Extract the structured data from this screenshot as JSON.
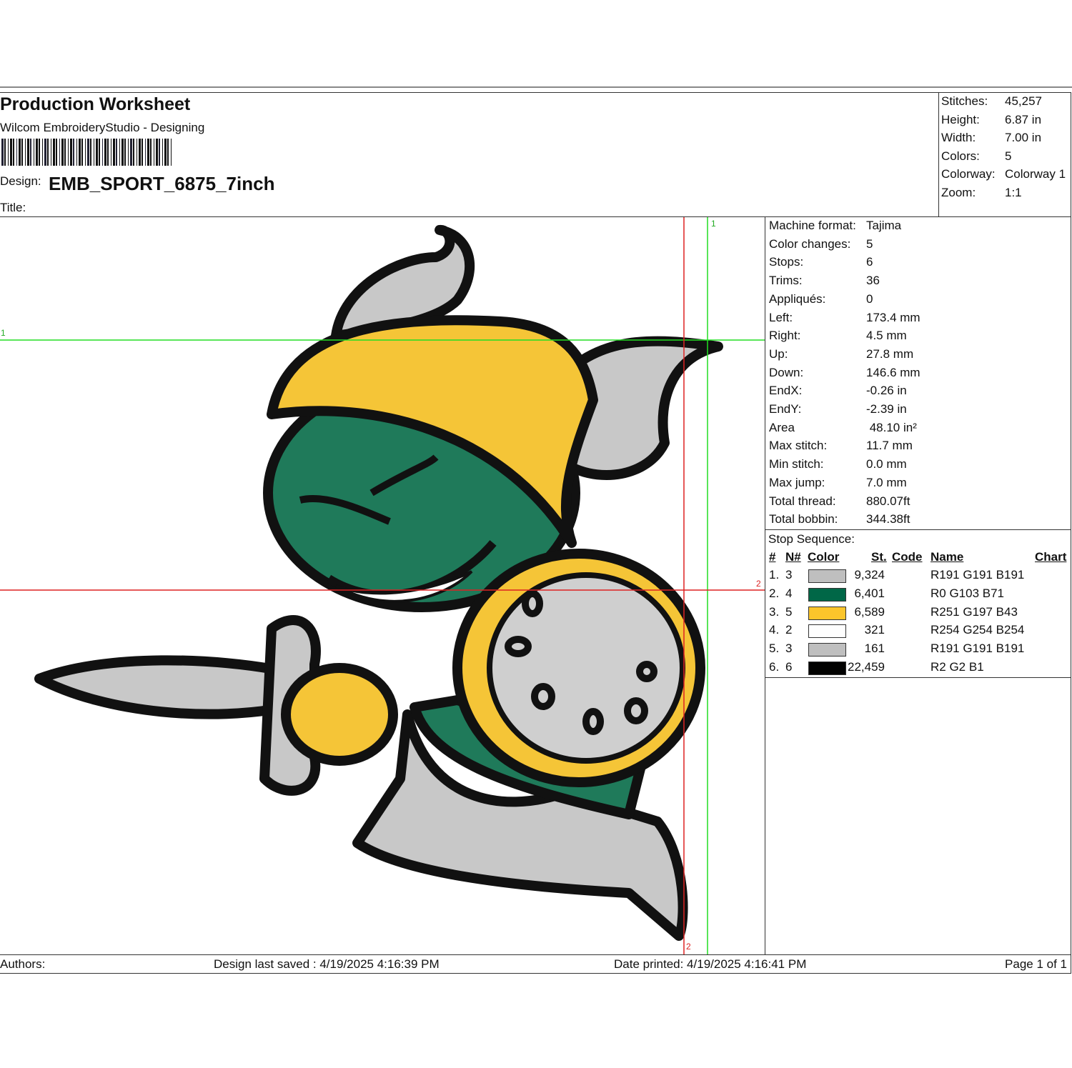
{
  "header": {
    "title": "Production Worksheet",
    "subtitle": "Wilcom EmbroideryStudio - Designing",
    "design_label": "Design:",
    "design_value": "EMB_SPORT_6875_7inch",
    "title_label": "Title:",
    "title_value": ""
  },
  "stats": [
    {
      "k": "Stitches:",
      "v": "45,257"
    },
    {
      "k": "Height:",
      "v": "6.87 in"
    },
    {
      "k": "Width:",
      "v": "7.00 in"
    },
    {
      "k": "Colors:",
      "v": "5"
    },
    {
      "k": "Colorway:",
      "v": "Colorway 1"
    },
    {
      "k": "Zoom:",
      "v": "1:1"
    }
  ],
  "info": [
    {
      "k": "Machine format:",
      "v": "Tajima"
    },
    {
      "k": "Color changes:",
      "v": "5"
    },
    {
      "k": "Stops:",
      "v": "6"
    },
    {
      "k": "Trims:",
      "v": "36"
    },
    {
      "k": "Appliqués:",
      "v": "0"
    },
    {
      "k": "Left:",
      "v": "173.4 mm"
    },
    {
      "k": "Right:",
      "v": "4.5 mm"
    },
    {
      "k": "Up:",
      "v": "27.8 mm"
    },
    {
      "k": "Down:",
      "v": "146.6 mm"
    },
    {
      "k": "EndX:",
      "v": "-0.26 in"
    },
    {
      "k": "EndY:",
      "v": "-2.39 in"
    },
    {
      "k": "Area",
      "v": " 48.10 in²"
    },
    {
      "k": "Max stitch:",
      "v": "11.7 mm"
    },
    {
      "k": "Min stitch:",
      "v": "0.0 mm"
    },
    {
      "k": "Max jump:",
      "v": "7.0 mm"
    },
    {
      "k": "Total thread:",
      "v": "880.07ft"
    },
    {
      "k": "Total bobbin:",
      "v": "344.38ft"
    }
  ],
  "stop_sequence": {
    "title": "Stop Sequence:",
    "headers": {
      "num": "#",
      "needle": "N#",
      "color": "Color",
      "stitches": "St.",
      "code": "Code",
      "name": "Name",
      "chart": "Chart"
    },
    "rows": [
      {
        "num": "1.",
        "needle": "3",
        "color": "#bfbfbf",
        "stitches": "9,324",
        "code": "",
        "name": "R191 G191 B191",
        "chart": ""
      },
      {
        "num": "2.",
        "needle": "4",
        "color": "#006747",
        "stitches": "6,401",
        "code": "",
        "name": "R0 G103 B71",
        "chart": ""
      },
      {
        "num": "3.",
        "needle": "5",
        "color": "#fbc52b",
        "stitches": "6,589",
        "code": "",
        "name": "R251 G197 B43",
        "chart": ""
      },
      {
        "num": "4.",
        "needle": "2",
        "color": "#fefefe",
        "stitches": "321",
        "code": "",
        "name": "R254 G254 B254",
        "chart": ""
      },
      {
        "num": "5.",
        "needle": "3",
        "color": "#bfbfbf",
        "stitches": "161",
        "code": "",
        "name": "R191 G191 B191",
        "chart": ""
      },
      {
        "num": "6.",
        "needle": "6",
        "color": "#020201",
        "stitches": "22,459",
        "code": "",
        "name": "R2 G2 B1",
        "chart": ""
      }
    ]
  },
  "guides": {
    "green_label": "1",
    "red_label": "2",
    "green": "#22dd22",
    "red": "#dd2222"
  },
  "footer": {
    "authors": "Authors:",
    "saved": "Design last saved : 4/19/2025 4:16:39 PM",
    "printed": "Date printed: 4/19/2025 4:16:41 PM",
    "page": "Page 1 of 1"
  }
}
